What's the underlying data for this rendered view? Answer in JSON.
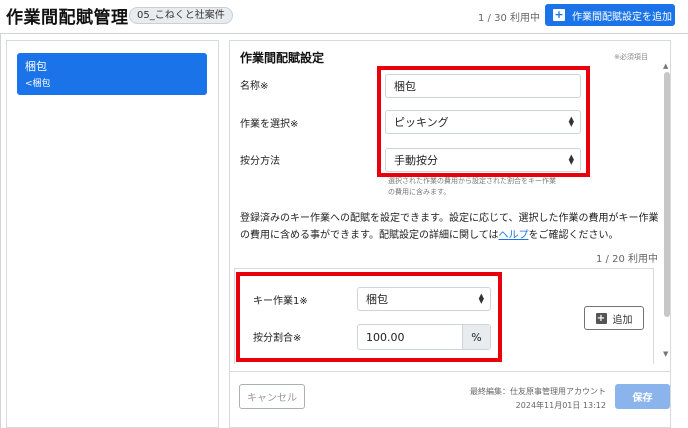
{
  "header": {
    "title": "作業間配賦管理",
    "badge": "05_こねくと社案件",
    "usage": "1 / 30 利用中",
    "add_button": "作業間配賦設定を追加"
  },
  "sidebar": {
    "items": [
      {
        "label": "梱包",
        "sub": "<梱包"
      }
    ]
  },
  "form": {
    "section_title": "作業間配賦設定",
    "required_note": "※必須項目",
    "name_label": "名称※",
    "name_value": "梱包",
    "task_label": "作業を選択※",
    "task_value": "ピッキング",
    "method_label": "按分方法",
    "method_value": "手動按分",
    "method_help_1": "選択された作業の費用から設定された割合をキー作業",
    "method_help_2": "の費用に含みます。",
    "desc_pre": "登録済みのキー作業への配賦を設定できます。設定に応じて、選択した作業の費用がキー作業の費用に含める事ができます。配賦設定の詳細に関しては",
    "desc_link": "ヘルプ",
    "desc_post": "をご確認ください。",
    "key_count": "1 / 20 利用中",
    "key_task_label": "キー作業1※",
    "key_task_value": "梱包",
    "ratio_label": "按分割合※",
    "ratio_value": "100.00",
    "ratio_unit": "%",
    "add_label": "追加"
  },
  "footer": {
    "cancel": "キャンセル",
    "last_edit": "最終編集：仕友原事管理用アカウント",
    "timestamp": "2024年11月01日 13:12",
    "save": "保存"
  },
  "colors": {
    "accent": "#1a73e8",
    "highlight": "#e8000b",
    "save_disabled": "#8cb4ec"
  }
}
